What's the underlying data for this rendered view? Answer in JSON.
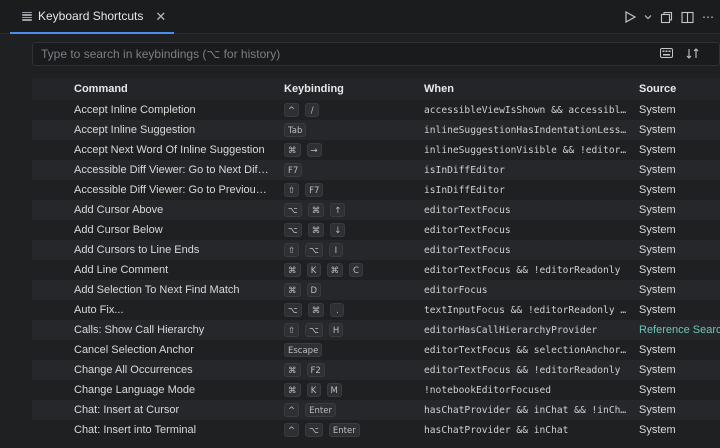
{
  "tab": {
    "title": "Keyboard Shortcuts",
    "close": "✕"
  },
  "actions": {
    "run": "▷",
    "run_menu": "⌵",
    "split": "⧉",
    "more": "⋯"
  },
  "search": {
    "placeholder": "Type to search in keybindings (⌥ for history)"
  },
  "columns": {
    "command": "Command",
    "keybinding": "Keybinding",
    "when": "When",
    "source": "Source"
  },
  "rows": [
    {
      "command": "Accept Inline Completion",
      "keys": [
        "^",
        "/"
      ],
      "when": "accessibleViewIsShown && accessibl…",
      "source": "System"
    },
    {
      "command": "Accept Inline Suggestion",
      "keys": [
        "Tab"
      ],
      "when": "inlineSuggestionHasIndentationLess…",
      "source": "System"
    },
    {
      "command": "Accept Next Word Of Inline Suggestion",
      "keys": [
        "⌘",
        "→"
      ],
      "when": "inlineSuggestionVisible && !editor…",
      "source": "System"
    },
    {
      "command": "Accessible Diff Viewer: Go to Next Dif…",
      "keys": [
        "F7"
      ],
      "when": "isInDiffEditor",
      "source": "System"
    },
    {
      "command": "Accessible Diff Viewer: Go to Previou…",
      "keys": [
        "⇧",
        "F7"
      ],
      "when": "isInDiffEditor",
      "source": "System"
    },
    {
      "command": "Add Cursor Above",
      "keys": [
        "⌥",
        "⌘",
        "↑"
      ],
      "when": "editorTextFocus",
      "source": "System"
    },
    {
      "command": "Add Cursor Below",
      "keys": [
        "⌥",
        "⌘",
        "↓"
      ],
      "when": "editorTextFocus",
      "source": "System"
    },
    {
      "command": "Add Cursors to Line Ends",
      "keys": [
        "⇧",
        "⌥",
        "I"
      ],
      "when": "editorTextFocus",
      "source": "System"
    },
    {
      "command": "Add Line Comment",
      "keys": [
        "⌘",
        "K",
        "⌘",
        "C"
      ],
      "when": "editorTextFocus && !editorReadonly",
      "source": "System"
    },
    {
      "command": "Add Selection To Next Find Match",
      "keys": [
        "⌘",
        "D"
      ],
      "when": "editorFocus",
      "source": "System"
    },
    {
      "command": "Auto Fix...",
      "keys": [
        "⌥",
        "⌘",
        "."
      ],
      "when": "textInputFocus && !editorReadonly …",
      "source": "System"
    },
    {
      "command": "Calls: Show Call Hierarchy",
      "keys": [
        "⇧",
        "⌥",
        "H"
      ],
      "when": "editorHasCallHierarchyProvider",
      "source": "Reference Search",
      "source_link": true
    },
    {
      "command": "Cancel Selection Anchor",
      "keys": [
        "Escape"
      ],
      "when": "editorTextFocus && selectionAnchor…",
      "source": "System"
    },
    {
      "command": "Change All Occurrences",
      "keys": [
        "⌘",
        "F2"
      ],
      "when": "editorTextFocus && !editorReadonly",
      "source": "System"
    },
    {
      "command": "Change Language Mode",
      "keys": [
        "⌘",
        "K",
        "M"
      ],
      "when": "!notebookEditorFocused",
      "source": "System"
    },
    {
      "command": "Chat: Insert at Cursor",
      "keys": [
        "^",
        "Enter"
      ],
      "when": "hasChatProvider && inChat && !inCh…",
      "source": "System"
    },
    {
      "command": "Chat: Insert into Terminal",
      "keys": [
        "^",
        "⌥",
        "Enter"
      ],
      "when": "hasChatProvider && inChat",
      "source": "System"
    }
  ]
}
